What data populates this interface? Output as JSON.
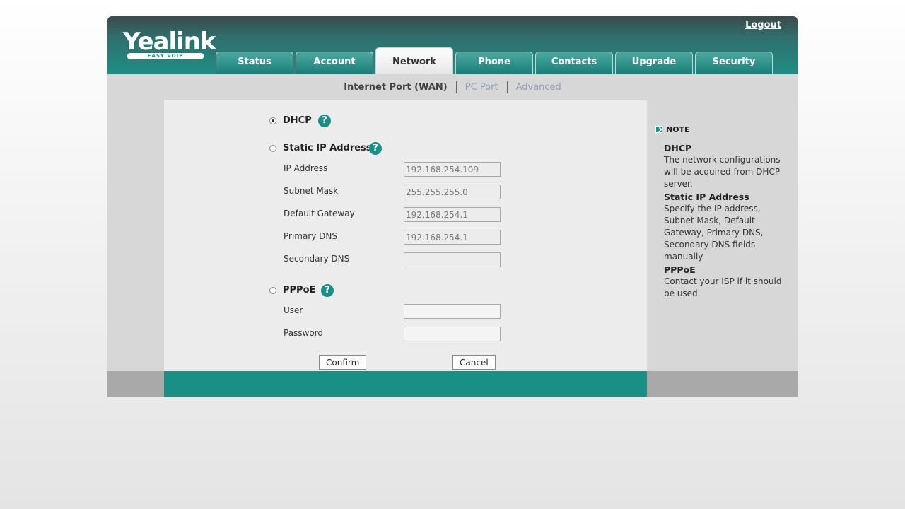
{
  "header": {
    "logo_text": "Yealink",
    "logo_subtext": "EASY VOIP",
    "logout_label": "Logout"
  },
  "tabs": [
    {
      "label": "Status"
    },
    {
      "label": "Account"
    },
    {
      "label": "Network",
      "active": true
    },
    {
      "label": "Phone"
    },
    {
      "label": "Contacts"
    },
    {
      "label": "Upgrade"
    },
    {
      "label": "Security"
    }
  ],
  "subnav": {
    "current": "Internet Port (WAN)",
    "links": [
      "PC Port",
      "Advanced"
    ]
  },
  "form": {
    "dhcp_label": "DHCP",
    "static_label": "Static IP Address",
    "pppoe_label": "PPPoE",
    "help_glyph": "?",
    "selected_mode": "DHCP",
    "static_fields": [
      {
        "label": "IP Address",
        "value": "192.168.254.109"
      },
      {
        "label": "Subnet Mask",
        "value": "255.255.255.0"
      },
      {
        "label": "Default Gateway",
        "value": "192.168.254.1"
      },
      {
        "label": "Primary DNS",
        "value": "192.168.254.1"
      },
      {
        "label": "Secondary DNS",
        "value": ""
      }
    ],
    "pppoe_fields": [
      {
        "label": "User",
        "value": ""
      },
      {
        "label": "Password",
        "value": ""
      }
    ],
    "confirm_label": "Confirm",
    "cancel_label": "Cancel"
  },
  "note": {
    "heading": "NOTE",
    "items": [
      {
        "title": "DHCP",
        "text": "The network configurations will be acquired from DHCP server."
      },
      {
        "title": "Static IP Address",
        "text": "Specify the IP address, Subnet Mask, Default Gateway, Primary DNS, Secondary DNS fields manually."
      },
      {
        "title": "PPPoE",
        "text": "Contact your ISP if it should be used."
      }
    ]
  },
  "colors": {
    "brand_teal": "#1a8f86",
    "panel_gray": "#d7d7d7",
    "content_bg": "#ececec"
  }
}
